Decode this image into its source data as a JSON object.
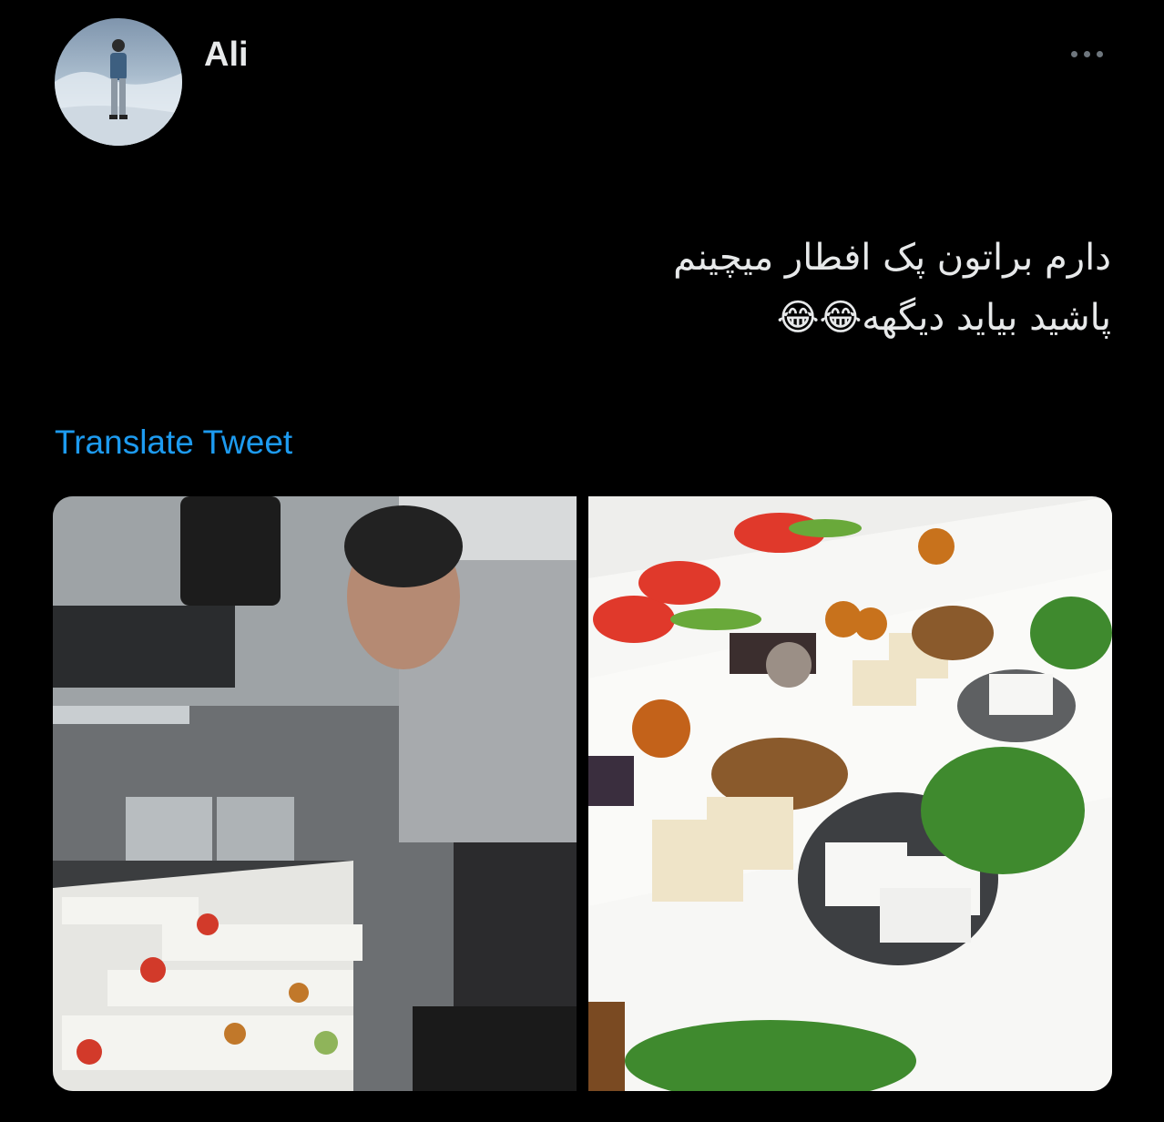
{
  "tweet": {
    "author": {
      "name": "Ali"
    },
    "text_lines": [
      "دارم براتون پک افطار میچینم",
      "پاشید بیاید دیگهه😂😂"
    ],
    "translate_label": "Translate Tweet",
    "media": [
      {
        "kind": "photo",
        "subject": "chef arranging iftar plates"
      },
      {
        "kind": "photo",
        "subject": "iftar plates with tomato, cucumber, cheese, walnuts, dates and herbs"
      }
    ]
  },
  "icons": {
    "more": "more-horizontal-icon"
  },
  "colors": {
    "background": "#000000",
    "text": "#e7e9ea",
    "link": "#1d9bf0",
    "muted": "#6e767d"
  }
}
